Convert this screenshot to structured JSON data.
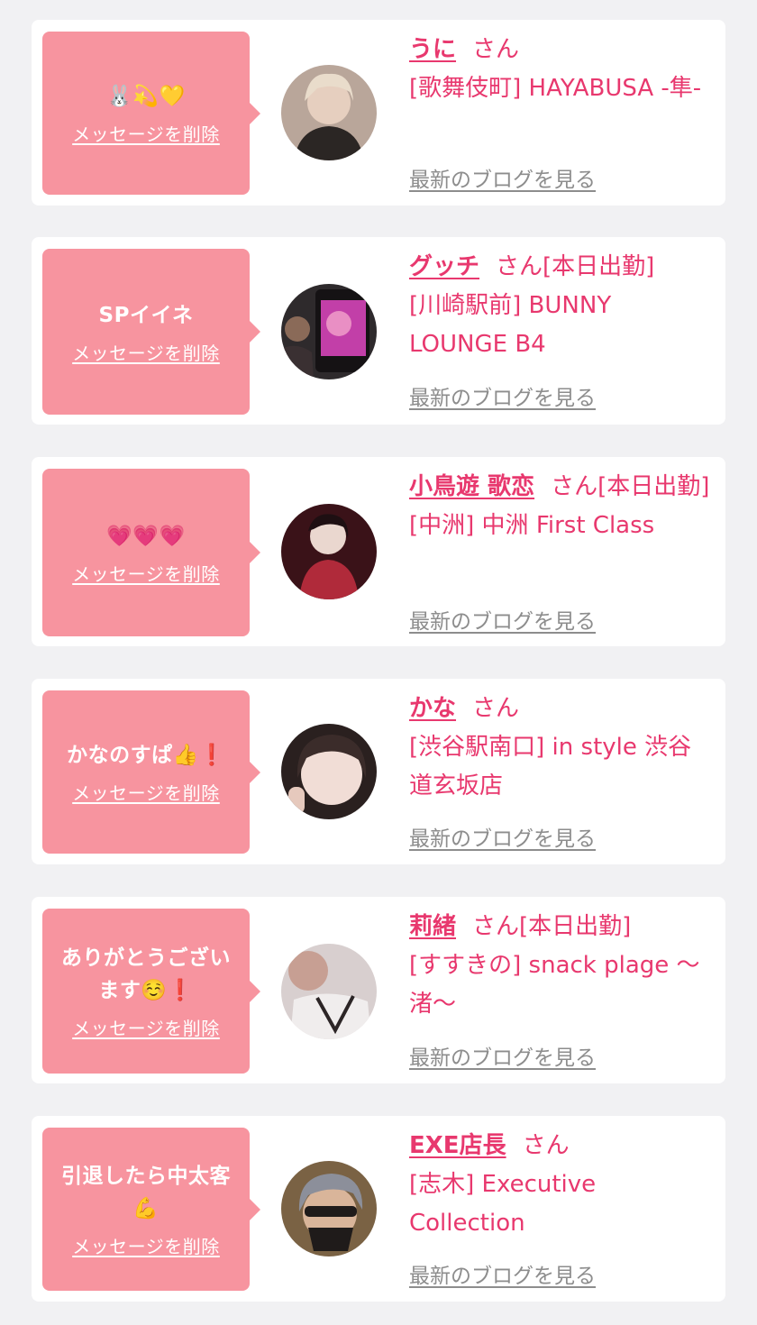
{
  "delete_label": "メッセージを削除",
  "blog_label": "最新のブログを見る",
  "colors": {
    "background": "#f1f1f3",
    "card": "#ffffff",
    "bubble": "#f7949f",
    "accent": "#e8386e",
    "link_gray": "#8d8d8d"
  },
  "messages": [
    {
      "message": "🐰💫💛",
      "name": "うに",
      "suffix": "さん",
      "shop": "[歌舞伎町] HAYABUSA -隼-",
      "avatar_colors": [
        "#d9c6b4",
        "#7a6a5e",
        "#2a2522"
      ]
    },
    {
      "message": "SPイイネ",
      "name": "グッチ",
      "suffix": "さん[本日出勤]",
      "shop": "[川崎駅前] BUNNY LOUNGE B4",
      "avatar_colors": [
        "#c23fa8",
        "#3b2b34",
        "#1d1a1c"
      ]
    },
    {
      "message": "💗💗💗",
      "name": "小鳥遊 歌恋",
      "suffix": "さん[本日出勤]",
      "shop": "[中洲] 中洲 First Class",
      "avatar_colors": [
        "#e7d6cf",
        "#b02a3a",
        "#3a1218"
      ]
    },
    {
      "message": "かなのすぱ👍❗",
      "name": "かな",
      "suffix": "さん",
      "shop": "[渋谷駅南口] in style 渋谷道玄坂店",
      "avatar_colors": [
        "#f1ddd6",
        "#d3b3a8",
        "#3b2c2a"
      ]
    },
    {
      "message": "ありがとうございます☺️❗",
      "name": "莉緒",
      "suffix": "さん[本日出勤]",
      "shop": "[すすきの] snack plage ～渚～",
      "avatar_colors": [
        "#e9e6e6",
        "#c2b1ad",
        "#2c2526"
      ]
    },
    {
      "message": "引退したら中太客💪",
      "name": "EXE店長",
      "suffix": "さん",
      "shop": "[志木] Executive Collection",
      "avatar_colors": [
        "#b59b6f",
        "#5d4a3a",
        "#1f1b1a"
      ]
    }
  ]
}
